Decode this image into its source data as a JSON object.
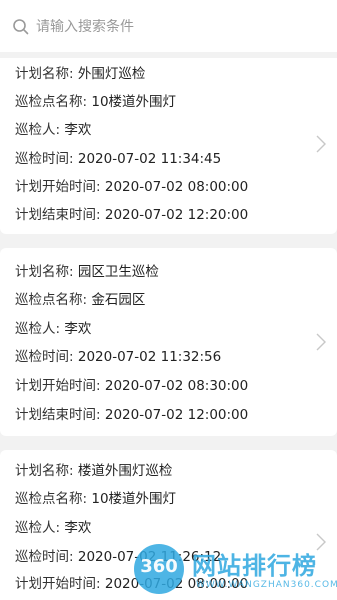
{
  "search": {
    "placeholder": "请输入搜索条件",
    "icon": "search-icon"
  },
  "records": [
    {
      "plan_name_label": "计划名称:",
      "plan_name": "外围灯巡检",
      "point_label": "巡检点名称:",
      "point": "10楼道外围灯",
      "inspector_label": "巡检人:",
      "inspector": "李欢",
      "time_label": "巡检时间:",
      "time": "2020-07-02 11:34:45",
      "start_label": "计划开始时间:",
      "start": "2020-07-02 08:00:00",
      "end_label": "计划结束时间:",
      "end": "2020-07-02 12:20:00"
    },
    {
      "plan_name_label": "计划名称:",
      "plan_name": "园区卫生巡检",
      "point_label": "巡检点名称:",
      "point": "金石园区",
      "inspector_label": "巡检人:",
      "inspector": "李欢",
      "time_label": "巡检时间:",
      "time": "2020-07-02 11:32:56",
      "start_label": "计划开始时间:",
      "start": "2020-07-02 08:30:00",
      "end_label": "计划结束时间:",
      "end": "2020-07-02 12:00:00"
    },
    {
      "plan_name_label": "计划名称:",
      "plan_name": "楼道外围灯巡检",
      "point_label": "巡检点名称:",
      "point": "10楼道外围灯",
      "inspector_label": "巡检人:",
      "inspector": "李欢",
      "time_label": "巡检时间:",
      "time": "2020-07-02 11:26:12",
      "start_label": "计划开始时间:",
      "start": "2020-07-02 08:00:00"
    }
  ],
  "watermark": {
    "badge": "360",
    "title": "网站排行榜",
    "subtitle": "WWW.WANGZHAN360.COM"
  },
  "colors": {
    "background": "#f2f2f2",
    "card": "#ffffff",
    "text": "#333333",
    "placeholder": "#9a9a9a",
    "chevron": "#c8c8c8",
    "watermark": "#2fa8e0"
  }
}
